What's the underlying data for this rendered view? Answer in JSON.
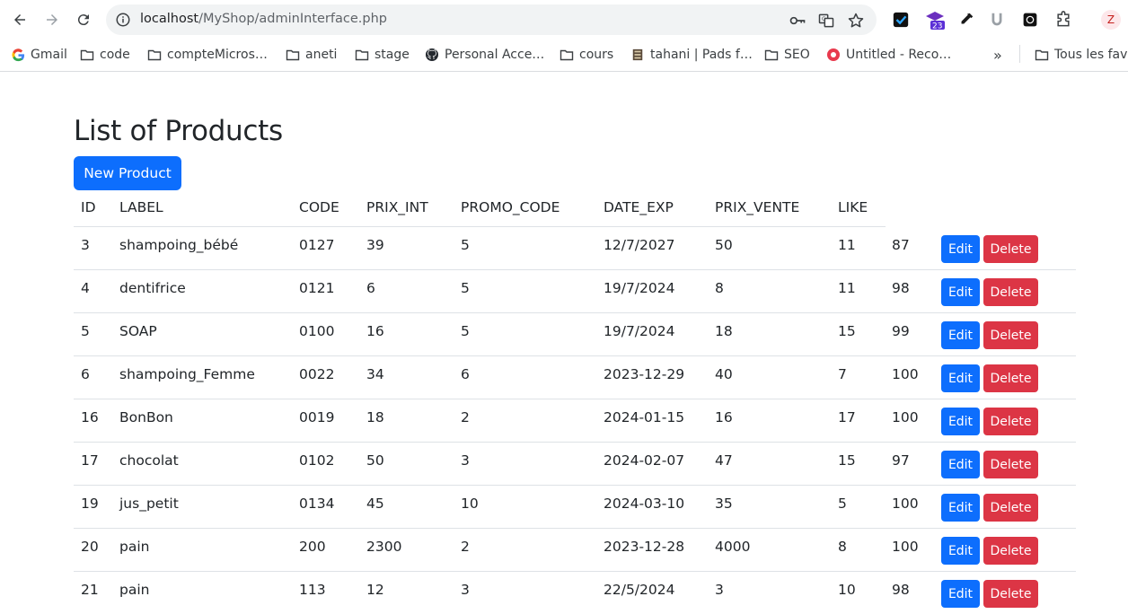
{
  "browser": {
    "url_host": "localhost",
    "url_path": "/MyShop/adminInterface.php",
    "extension_badge": "23",
    "profile_initial": "Z",
    "bookmarks": [
      {
        "label": "Gmail",
        "icon": "google-icon"
      },
      {
        "label": "code",
        "icon": "folder-icon"
      },
      {
        "label": "compteMicros…",
        "icon": "folder-icon"
      },
      {
        "label": "aneti",
        "icon": "folder-icon"
      },
      {
        "label": "stage",
        "icon": "folder-icon"
      },
      {
        "label": "Personal Acce…",
        "icon": "github-icon"
      },
      {
        "label": "cours",
        "icon": "folder-icon"
      },
      {
        "label": "tahani | Pads f…",
        "icon": "pads-icon"
      },
      {
        "label": "SEO",
        "icon": "folder-icon"
      },
      {
        "label": "Untitled - Reco…",
        "icon": "record-icon"
      }
    ],
    "more_bookmarks": "»",
    "all_bookmarks_label": "Tous les favoris"
  },
  "page": {
    "title": "List of Products",
    "new_button": "New Product"
  },
  "table": {
    "headers": [
      "ID",
      "LABEL",
      "CODE",
      "PRIX_INT",
      "PROMO_CODE",
      "DATE_EXP",
      "PRIX_VENTE",
      "LIKE"
    ],
    "edit_label": "Edit",
    "delete_label": "Delete",
    "rows": [
      [
        "3",
        "shampoing_bébé",
        "0127",
        "39",
        "5",
        "12/7/2027",
        "50",
        "11",
        "87"
      ],
      [
        "4",
        "dentifrice",
        "0121",
        "6",
        "5",
        "19/7/2024",
        "8",
        "11",
        "98"
      ],
      [
        "5",
        "SOAP",
        "0100",
        "16",
        "5",
        "19/7/2024",
        "18",
        "15",
        "99"
      ],
      [
        "6",
        "shampoing_Femme",
        "0022",
        "34",
        "6",
        "2023-12-29",
        "40",
        "7",
        "100"
      ],
      [
        "16",
        "BonBon",
        "0019",
        "18",
        "2",
        "2024-01-15",
        "16",
        "17",
        "100"
      ],
      [
        "17",
        "chocolat",
        "0102",
        "50",
        "3",
        "2024-02-07",
        "47",
        "15",
        "97"
      ],
      [
        "19",
        "jus_petit",
        "0134",
        "45",
        "10",
        "2024-03-10",
        "35",
        "5",
        "100"
      ],
      [
        "20",
        "pain",
        "200",
        "2300",
        "2",
        "2023-12-28",
        "4000",
        "8",
        "100"
      ],
      [
        "21",
        "pain",
        "113",
        "12",
        "3",
        "22/5/2024",
        "3",
        "10",
        "98"
      ]
    ]
  },
  "colors": {
    "primary": "#0d6efd",
    "danger": "#dc3545",
    "text": "#212529",
    "border": "#dee2e6"
  }
}
